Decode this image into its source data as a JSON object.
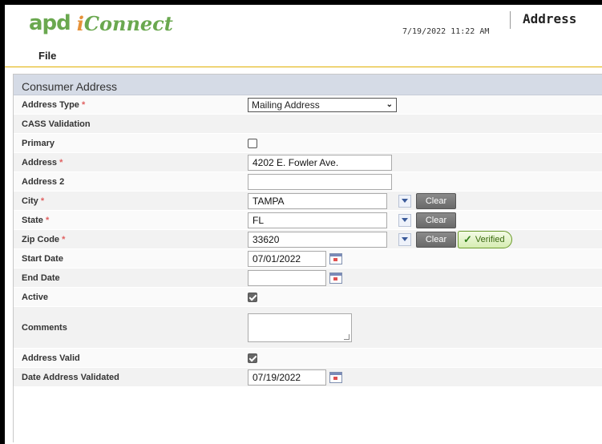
{
  "app": {
    "logo_apd": "apd",
    "logo_i": "i",
    "logo_connect": "Connect"
  },
  "header": {
    "timestamp": "7/19/2022 11:22 AM",
    "title": "Address"
  },
  "menu": {
    "file": "File"
  },
  "section": {
    "title": "Consumer Address"
  },
  "fields": {
    "address_type": {
      "label": "Address Type",
      "value": "Mailing Address",
      "required": true
    },
    "cass_validation": {
      "label": "CASS Validation"
    },
    "primary": {
      "label": "Primary",
      "checked": false
    },
    "address": {
      "label": "Address",
      "value": "4202 E. Fowler Ave.",
      "required": true
    },
    "address2": {
      "label": "Address 2",
      "value": ""
    },
    "city": {
      "label": "City",
      "value": "TAMPA",
      "required": true
    },
    "state": {
      "label": "State",
      "value": "FL",
      "required": true
    },
    "zip": {
      "label": "Zip Code",
      "value": "33620",
      "required": true,
      "status": "Verified"
    },
    "start_date": {
      "label": "Start Date",
      "value": "07/01/2022"
    },
    "end_date": {
      "label": "End Date",
      "value": ""
    },
    "active": {
      "label": "Active",
      "checked": true
    },
    "comments": {
      "label": "Comments",
      "value": ""
    },
    "address_valid": {
      "label": "Address Valid",
      "checked": true
    },
    "date_validated": {
      "label": "Date Address Validated",
      "value": "07/19/2022"
    }
  },
  "buttons": {
    "clear": "Clear"
  },
  "required_marker": "*",
  "colors": {
    "brand_green": "#6aa84f",
    "brand_orange": "#e69138",
    "section_bg": "#d5dbe6",
    "required": "#e06060"
  }
}
